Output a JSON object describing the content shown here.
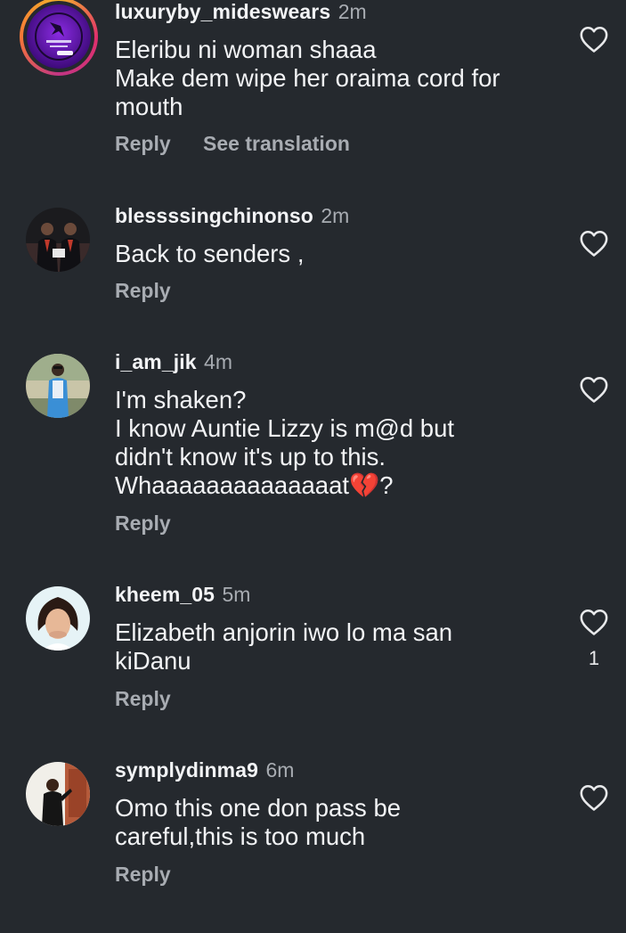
{
  "comments": [
    {
      "username": "luxuryby_mideswears",
      "time": "2m",
      "text": "Eleribu ni woman shaaa\nMake dem wipe her oraima cord for\nmouth",
      "reply": "Reply",
      "see_translation": "See translation",
      "like_icon": "heart-outline-icon"
    },
    {
      "username": "blessssingchinonso",
      "time": "2m",
      "text": "Back to senders ,",
      "reply": "Reply",
      "like_icon": "heart-outline-icon"
    },
    {
      "username": "i_am_jik",
      "time": "4m",
      "text": "I'm shaken?\nI know Auntie Lizzy is m@d but\ndidn't know it's up to this.\nWhaaaaaaaaaaaaaat💔?",
      "reply": "Reply",
      "like_icon": "heart-outline-icon"
    },
    {
      "username": "kheem_05",
      "time": "5m",
      "text": "Elizabeth anjorin iwo lo ma san\nkiDanu",
      "reply": "Reply",
      "like_count": "1",
      "like_icon": "heart-outline-icon"
    },
    {
      "username": "symplydinma9",
      "time": "6m",
      "text": "Omo this one don pass be\ncareful,this is too much",
      "reply": "Reply",
      "like_icon": "heart-outline-icon"
    }
  ],
  "colors": {
    "background": "#25292e",
    "primary_text": "#f2f3f5",
    "secondary_text": "#a8acb2"
  }
}
